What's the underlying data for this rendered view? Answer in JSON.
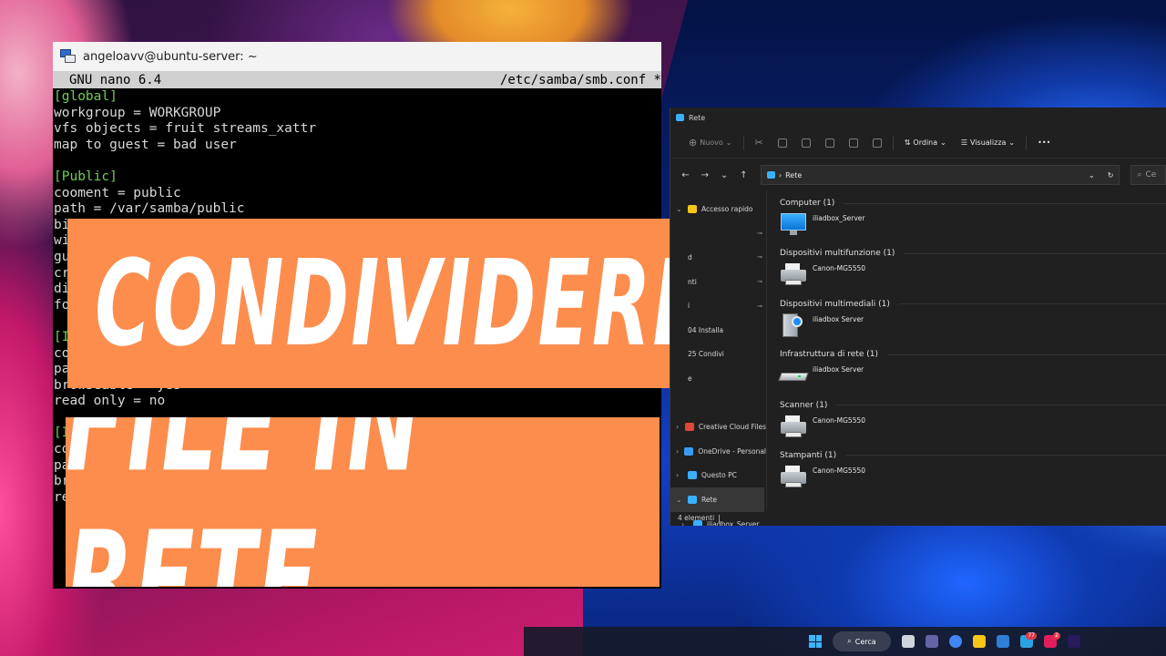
{
  "terminal": {
    "title": "angeloavv@ubuntu-server: ~",
    "nano_version": "GNU nano 6.4",
    "file_path": "/etc/samba/smb.conf *",
    "lines": [
      {
        "text": "[global]",
        "section": true
      },
      {
        "text": "workgroup = WORKGROUP",
        "section": false
      },
      {
        "text": "vfs objects = fruit streams_xattr",
        "section": false
      },
      {
        "text": "map to guest = bad user",
        "section": false
      },
      {
        "text": "",
        "section": false
      },
      {
        "text": "[Public]",
        "section": true
      },
      {
        "text": "cooment = public",
        "section": false
      },
      {
        "text": "path = /var/samba/public",
        "section": false
      },
      {
        "text": "bi",
        "section": false
      },
      {
        "text": "wi",
        "section": false
      },
      {
        "text": "gu",
        "section": false
      },
      {
        "text": "cr",
        "section": false
      },
      {
        "text": "di",
        "section": false
      },
      {
        "text": "fo",
        "section": false
      },
      {
        "text": "",
        "section": false
      },
      {
        "text": "[I",
        "section": true
      },
      {
        "text": "co",
        "section": false
      },
      {
        "text": "pa",
        "section": false
      },
      {
        "text": "browseable = yes",
        "section": false
      },
      {
        "text": "read only = no",
        "section": false
      },
      {
        "text": "",
        "section": false
      },
      {
        "text": "[I",
        "section": true
      },
      {
        "text": "co",
        "section": false
      },
      {
        "text": "pa",
        "section": false
      },
      {
        "text": "br",
        "section": false
      },
      {
        "text": "re",
        "section": false
      }
    ]
  },
  "banners": {
    "line1": "CONDIVIDERE",
    "line2": "FILE IN RETE"
  },
  "explorer": {
    "window_title": "Rete",
    "toolbar": {
      "new_label": "Nuovo",
      "sort_label": "Ordina",
      "view_label": "Visualizza",
      "more_label": "•••"
    },
    "address": {
      "location": "Rete",
      "search_placeholder": "Ce"
    },
    "nav": [
      {
        "label": "Accesso rapido",
        "chevron": "⌄",
        "pinned": false,
        "color": "#f5c518",
        "selected": false
      },
      {
        "label": "",
        "chevron": "",
        "pinned": true,
        "color": "",
        "selected": false
      },
      {
        "label": "d",
        "chevron": "",
        "pinned": true,
        "color": "",
        "selected": false
      },
      {
        "label": "nti",
        "chevron": "",
        "pinned": true,
        "color": "",
        "selected": false
      },
      {
        "label": "i",
        "chevron": "",
        "pinned": true,
        "color": "",
        "selected": false
      },
      {
        "label": "04 Installa",
        "chevron": "",
        "pinned": false,
        "color": "",
        "selected": false
      },
      {
        "label": "25 Condivi",
        "chevron": "",
        "pinned": false,
        "color": "",
        "selected": false
      },
      {
        "label": "e",
        "chevron": "",
        "pinned": false,
        "color": "",
        "selected": false
      },
      {
        "label": "",
        "chevron": "",
        "pinned": false,
        "color": "",
        "selected": false
      },
      {
        "label": "Creative Cloud Files",
        "chevron": "›",
        "pinned": false,
        "color": "#e0463a",
        "selected": false
      },
      {
        "label": "OneDrive - Personal",
        "chevron": "›",
        "pinned": false,
        "color": "#3a9cf0",
        "selected": false
      },
      {
        "label": "Questo PC",
        "chevron": "›",
        "pinned": false,
        "color": "#3ab0ff",
        "selected": false
      },
      {
        "label": "Rete",
        "chevron": "⌄",
        "pinned": false,
        "color": "#3ab0ff",
        "selected": true
      },
      {
        "label": "iliadbox_Server",
        "chevron": "›",
        "pinned": false,
        "color": "#3ab0ff",
        "selected": false
      }
    ],
    "groups": [
      {
        "header": "Computer (1)",
        "item": "iliadbox_Server",
        "icon": "monitor"
      },
      {
        "header": "Dispositivi multifunzione (1)",
        "item": "Canon-MG5550",
        "icon": "printer"
      },
      {
        "header": "Dispositivi multimediali (1)",
        "item": "iliadbox Server",
        "icon": "media"
      },
      {
        "header": "Infrastruttura di rete (1)",
        "item": "iliadbox Server",
        "icon": "router"
      },
      {
        "header": "Scanner (1)",
        "item": "Canon-MG5550",
        "icon": "printer"
      },
      {
        "header": "Stampanti (1)",
        "item": "Canon-MG5550",
        "icon": "printer"
      }
    ],
    "status": "4 elementi"
  },
  "taskbar": {
    "search_label": "Cerca",
    "apps": [
      {
        "name": "task-view",
        "color": "#cfd3dc",
        "badge": ""
      },
      {
        "name": "teams",
        "color": "#6264a7",
        "badge": ""
      },
      {
        "name": "chrome",
        "color": "#4285f4",
        "badge": ""
      },
      {
        "name": "file-explorer",
        "color": "#f5c518",
        "badge": ""
      },
      {
        "name": "mail",
        "color": "#2f7fd6",
        "badge": ""
      },
      {
        "name": "telegram",
        "color": "#2aa3e0",
        "badge": "77"
      },
      {
        "name": "slack",
        "color": "#e01e5a",
        "badge": "2"
      },
      {
        "name": "premiere",
        "color": "#2a1a5e",
        "badge": ""
      }
    ]
  },
  "colors": {
    "banner": "#fd8d4d",
    "terminal_section": "#6fcf50",
    "explorer_bg": "#202020"
  }
}
